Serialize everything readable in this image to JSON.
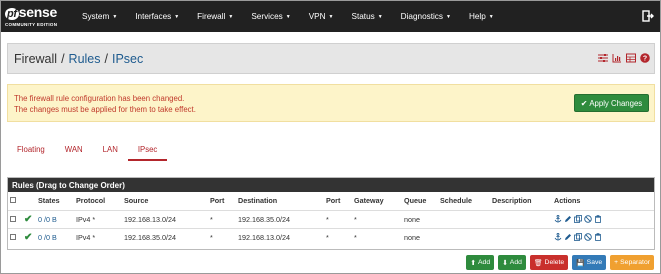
{
  "brand": {
    "logo_main": "sense",
    "logo_pf": "pf",
    "logo_sub": "COMMUNITY EDITION"
  },
  "nav": [
    "System",
    "Interfaces",
    "Firewall",
    "Services",
    "VPN",
    "Status",
    "Diagnostics",
    "Help"
  ],
  "breadcrumb": {
    "part1": "Firewall",
    "part2": "Rules",
    "part3": "IPsec"
  },
  "alert": {
    "line1": "The firewall rule configuration has been changed.",
    "line2": "The changes must be applied for them to take effect.",
    "apply_label": "Apply Changes"
  },
  "tabs": [
    "Floating",
    "WAN",
    "LAN",
    "IPsec"
  ],
  "panel_title": "Rules (Drag to Change Order)",
  "columns": [
    "",
    "",
    "States",
    "Protocol",
    "Source",
    "Port",
    "Destination",
    "Port",
    "Gateway",
    "Queue",
    "Schedule",
    "Description",
    "Actions"
  ],
  "rows": [
    {
      "states": "0 /0 B",
      "protocol": "IPv4 *",
      "source": "192.168.13.0/24",
      "sport": "*",
      "destination": "192.168.35.0/24",
      "dport": "*",
      "gateway": "*",
      "queue": "none",
      "schedule": "",
      "description": ""
    },
    {
      "states": "0 /0 B",
      "protocol": "IPv4 *",
      "source": "192.168.35.0/24",
      "sport": "*",
      "destination": "192.168.13.0/24",
      "dport": "*",
      "gateway": "*",
      "queue": "none",
      "schedule": "",
      "description": ""
    }
  ],
  "buttons": {
    "add_top": "Add",
    "add_bottom": "Add",
    "delete": "Delete",
    "save": "Save",
    "separator": "Separator"
  },
  "colors": {
    "nav_bg": "#212121",
    "accent_red": "#b3262c",
    "link_blue": "#1e5b8f",
    "success": "#2e8b3d"
  }
}
